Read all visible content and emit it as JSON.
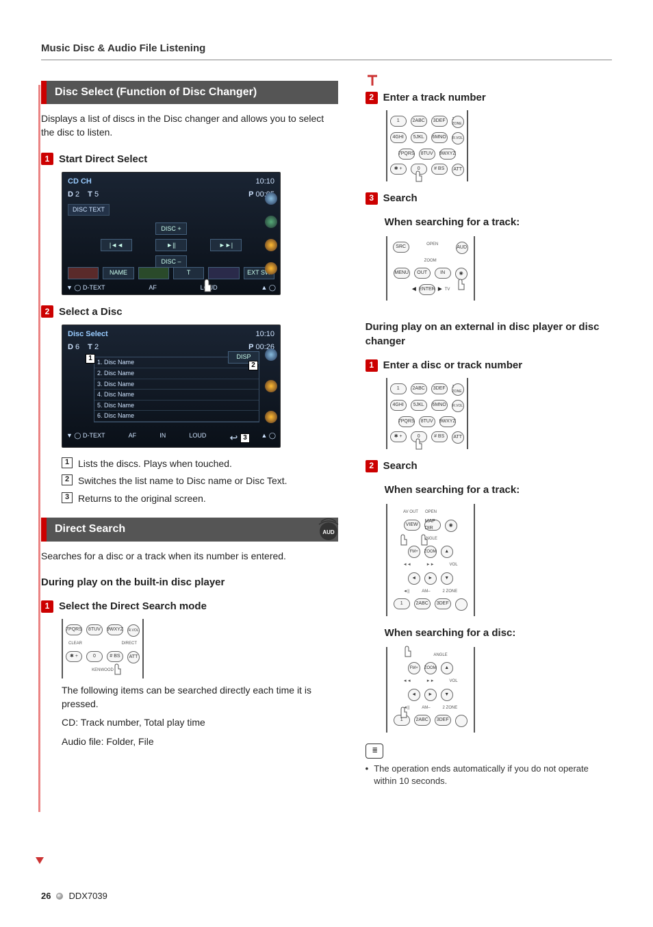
{
  "header": {
    "title": "Music Disc & Audio File Listening"
  },
  "footer": {
    "page_number": "26",
    "model": "DDX7039"
  },
  "left": {
    "disc_select": {
      "title": "Disc Select (Function of Disc Changer)",
      "intro": "Displays a list of discs in the Disc changer and allows you to select the disc to listen.",
      "step1": {
        "num": "1",
        "label": "Start Direct Select"
      },
      "screen1": {
        "mode": "CD CH",
        "clock": "10:10",
        "d_label": "D",
        "d_val": "2",
        "t_label": "T",
        "t_val": "5",
        "p_label": "P",
        "p_time": "00:05",
        "tab_disctext": "DISC TEXT",
        "btn_disc_plus": "DISC +",
        "btn_prev": "|◄◄",
        "btn_playpause": "►||",
        "btn_next": "►►|",
        "btn_disc_minus": "DISC –",
        "btn_name": "NAME",
        "btn_ext_sw": "EXT SW",
        "foot_dtext": "D-TEXT",
        "foot_af": "AF",
        "foot_loud": "LOUD"
      },
      "step2": {
        "num": "2",
        "label": "Select a Disc"
      },
      "screen2": {
        "title": "Disc Select",
        "clock": "10:10",
        "d_label": "D",
        "d_val": "6",
        "t_label": "T",
        "t_val": "2",
        "p_label": "P",
        "p_time": "00:26",
        "btn_disp": "DISP",
        "items": [
          "1. Disc Name",
          "2. Disc Name",
          "3. Disc Name",
          "4. Disc Name",
          "5. Disc Name",
          "6. Disc Name"
        ],
        "foot_dtext": "D-TEXT",
        "foot_af": "AF",
        "foot_in": "IN",
        "foot_loud": "LOUD",
        "marker1": "1",
        "marker2": "2",
        "marker3": "3"
      },
      "callouts": [
        {
          "num": "1",
          "text": "Lists the discs. Plays when touched."
        },
        {
          "num": "2",
          "text": "Switches the list name to Disc name or Disc Text."
        },
        {
          "num": "3",
          "text": "Returns to the original screen."
        }
      ]
    },
    "direct_search": {
      "title": "Direct Search",
      "badge": "AUD",
      "intro": "Searches for a disc or a track when its number is entered.",
      "subhead1": "During play on the built-in disc player",
      "step1": {
        "num": "1",
        "label": "Select the Direct Search mode"
      },
      "remote1_keys": {
        "r1": [
          "7PQRS",
          "8TUV",
          "9WXYZ"
        ],
        "r2": [
          "✱ +",
          "0",
          "# BS"
        ],
        "side_top": "R.VOL",
        "clear": "CLEAR",
        "direct": "DIRECT",
        "att": "ATT",
        "brand": "KENWOOD"
      },
      "following": "The following items can be searched directly each time it is pressed.",
      "cd_line": "CD: Track number, Total play time",
      "audio_line": "Audio file: Folder, File"
    }
  },
  "right": {
    "step2": {
      "num": "2",
      "label": "Enter a track number"
    },
    "remote2_keys": {
      "r1": [
        "1",
        "2ABC",
        "3DEF"
      ],
      "r2": [
        "4GHI",
        "5JKL",
        "6MNO"
      ],
      "r3": [
        "7PQRS",
        "8TUV",
        "9WXYZ"
      ],
      "r4": [
        "✱ +",
        "0",
        "# BS"
      ],
      "side_top": "2 ZONE",
      "side_mid": "R.VOL",
      "att": "ATT"
    },
    "step3": {
      "num": "3",
      "label": "Search"
    },
    "track_search_label": "When searching for a track:",
    "remote3_keys": {
      "src": "SRC",
      "aud": "AUD",
      "menu": "MENU",
      "out": "OUT",
      "in": "IN",
      "enter": "ENTER",
      "zoom": "ZOOM",
      "open": "OPEN",
      "tv": "TV"
    },
    "ext_heading": "During play on an external in disc player or disc changer",
    "ext_step1": {
      "num": "1",
      "label": "Enter a disc or track number"
    },
    "ext_step2": {
      "num": "2",
      "label": "Search"
    },
    "track_search_label2": "When searching for a track:",
    "remote4_keys": {
      "view": "VIEW",
      "mapdir": "MAP DIR",
      "avout": "AV OUT",
      "open": "OPEN",
      "angle": "ANGLE",
      "fm": "FM+",
      "zoom": "ZOOM",
      "vol": "VOL",
      "am": "AM–",
      "twozone": "2 ZONE",
      "k1": "1",
      "k2": "2ABC",
      "k3": "3DEF"
    },
    "disc_search_label": "When searching for a disc:",
    "remote5_keys": {
      "angle": "ANGLE",
      "fm": "FM+",
      "zoom": "ZOOM",
      "vol": "VOL",
      "am": "AM–",
      "twozone": "2 ZONE",
      "k1": "1",
      "k2": "2ABC",
      "k3": "3DEF"
    },
    "note": "The operation ends automatically if you do not operate within 10 seconds."
  }
}
